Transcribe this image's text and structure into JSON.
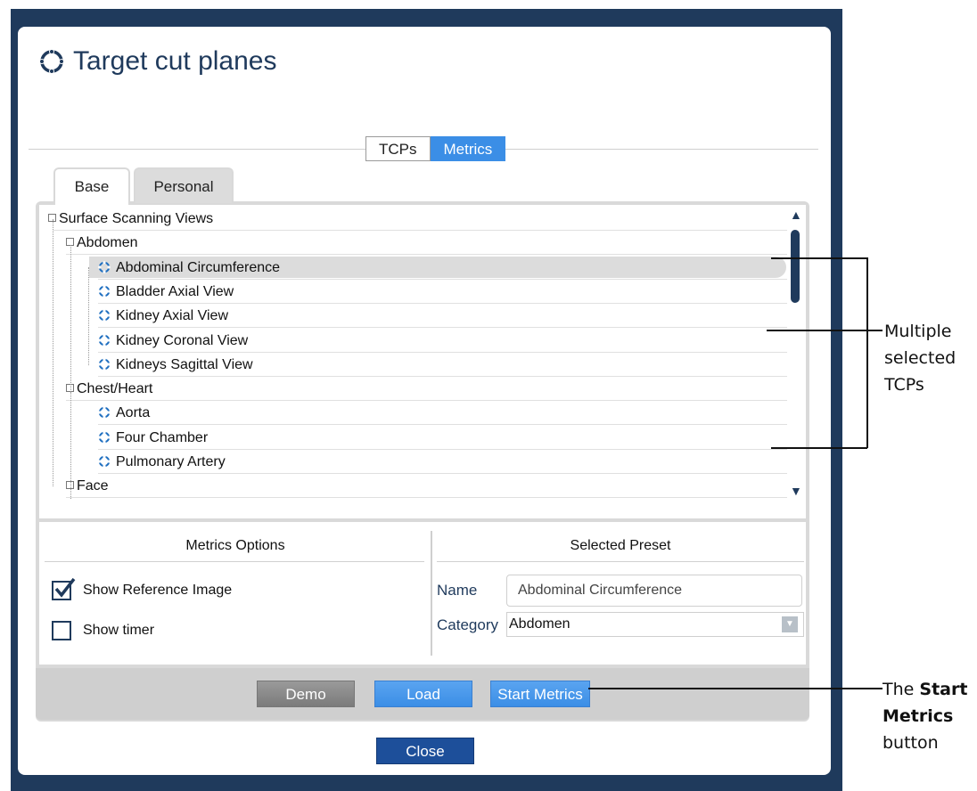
{
  "dialog": {
    "title": "Target cut planes"
  },
  "mode_switch": {
    "tcps_label": "TCPs",
    "metrics_label": "Metrics"
  },
  "tabs": {
    "base_label": "Base",
    "personal_label": "Personal"
  },
  "tree": {
    "root": "Surface Scanning Views",
    "groups": [
      {
        "label": "Abdomen",
        "items": [
          "Abdominal Circumference",
          "Bladder Axial View",
          "Kidney Axial View",
          "Kidney Coronal View",
          "Kidneys Sagittal View"
        ]
      },
      {
        "label": "Chest/Heart",
        "items": [
          "Aorta",
          "Four Chamber",
          "Pulmonary Artery"
        ]
      },
      {
        "label": "Face",
        "items": []
      }
    ],
    "selected_item": "Abdominal Circumference"
  },
  "metrics_options": {
    "title": "Metrics Options",
    "show_reference_image": {
      "label": "Show Reference Image",
      "checked": true
    },
    "show_timer": {
      "label": "Show timer",
      "checked": false
    }
  },
  "selected_preset": {
    "title": "Selected Preset",
    "name_label": "Name",
    "name_value": "Abdominal Circumference",
    "category_label": "Category",
    "category_value": "Abdomen"
  },
  "buttons": {
    "demo": "Demo",
    "load": "Load",
    "start_metrics": "Start Metrics",
    "close": "Close"
  },
  "callouts": {
    "multiple_line1": "Multiple",
    "multiple_line2": "selected",
    "multiple_line3": "TCPs",
    "start_prefix": "The ",
    "start_bold1": "Start",
    "start_bold2": "Metrics",
    "start_suffix": "button"
  },
  "colors": {
    "frame": "#1f3a5c",
    "accent_blue": "#3b8ee6",
    "close_button": "#1d4f9a"
  }
}
